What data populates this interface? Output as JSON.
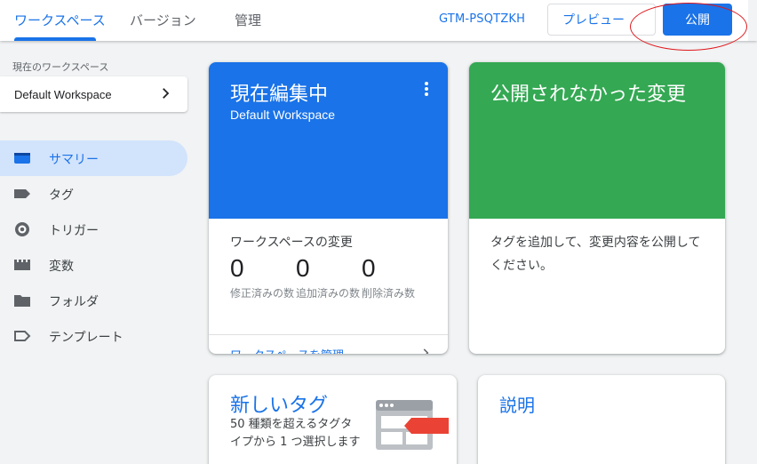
{
  "topbar": {
    "tabs": [
      {
        "label": "ワークスペース",
        "active": true
      },
      {
        "label": "バージョン",
        "active": false
      },
      {
        "label": "管理",
        "active": false
      }
    ],
    "container_id": "GTM-PSQTZKH",
    "preview_label": "プレビュー",
    "publish_label": "公開"
  },
  "sidebar": {
    "workspace_caption": "現在のワークスペース",
    "workspace_name": "Default Workspace",
    "items": [
      {
        "label": "サマリー",
        "icon": "summary-icon",
        "active": true
      },
      {
        "label": "タグ",
        "icon": "tag-icon",
        "active": false
      },
      {
        "label": "トリガー",
        "icon": "trigger-icon",
        "active": false
      },
      {
        "label": "変数",
        "icon": "variable-icon",
        "active": false
      },
      {
        "label": "フォルダ",
        "icon": "folder-icon",
        "active": false
      },
      {
        "label": "テンプレート",
        "icon": "template-icon",
        "active": false
      }
    ]
  },
  "cards": {
    "editing": {
      "title": "現在編集中",
      "workspace": "Default Workspace",
      "changes_title": "ワークスペースの変更",
      "stats": [
        {
          "value": "0",
          "label": "修正済みの数"
        },
        {
          "value": "0",
          "label": "追加済みの数"
        },
        {
          "value": "0",
          "label": "削除済み数"
        }
      ],
      "manage_link": "ワークスペースを管理"
    },
    "unpublished": {
      "title": "公開されなかった変更",
      "body": "タグを追加して、変更内容を公開してください。"
    },
    "new_tag": {
      "title": "新しいタグ",
      "body": "50 種類を超えるタグタイプから 1 つ選択します"
    },
    "description": {
      "title": "説明"
    }
  },
  "colors": {
    "accent_blue": "#1a73e8",
    "unpublished_green": "#34a853",
    "annotation_red": "#e0161b"
  }
}
